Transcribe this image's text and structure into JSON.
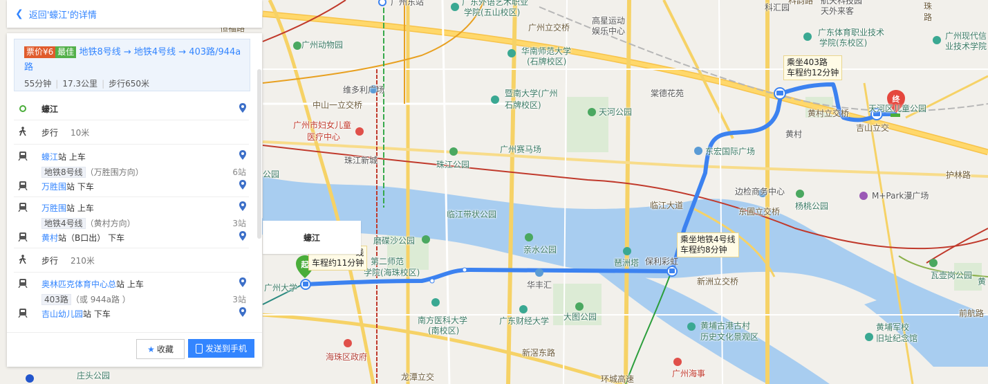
{
  "nav": {
    "back_label": "返回'蠔江'的详情"
  },
  "route": {
    "price_tag": "票价¥6",
    "best_tag": "最佳",
    "title": "地铁8号线 → 地铁4号线 → 403路/944a路",
    "duration": "55分钟",
    "distance": "17.3公里",
    "walk": "步行650米"
  },
  "steps": {
    "start": "蠔江",
    "walk1": "步行",
    "walk1_dist": "10米",
    "board1_station": "蠔江",
    "board1_suffix": "站  上车",
    "line1_name": "地铁8号线",
    "line1_dir": "（万胜围方向）",
    "line1_stops": "6站",
    "alight1_station": "万胜围",
    "alight1_suffix": "站  下车",
    "board2_station": "万胜围",
    "board2_suffix": "站  上车",
    "line2_name": "地铁4号线",
    "line2_dir": "（黄村方向）",
    "line2_stops": "3站",
    "alight2_station": "黄村",
    "alight2_suffix": "站（B口出）  下车",
    "walk2": "步行",
    "walk2_dist": "210米",
    "board3_station": "奥林匹克体育中心总",
    "board3_suffix": "站  上车",
    "line3_name": "403路",
    "line3_dir": "（或 944a路 ）",
    "line3_stops": "3站",
    "alight3_station": "吉山幼儿园",
    "alight3_suffix": "站  下车"
  },
  "footer": {
    "fav_label": "收藏",
    "send_label": "发送到手机"
  },
  "map": {
    "start_marker": "起",
    "end_marker": "终",
    "start_tag": "蠔江",
    "callouts": {
      "bus": [
        "乘坐403路",
        "车程约12分钟"
      ],
      "metro4": [
        "乘坐地铁4号线",
        "车程约8分钟"
      ],
      "metro8": [
        "线",
        "车程约11分钟"
      ]
    },
    "labels": {
      "l01": "广州东站",
      "l02": "广东外语艺术职业",
      "l03": "学院(五山校区)",
      "l04": "科韵路",
      "l05": "科汇园",
      "l06": "航天科技园",
      "l07": "天外来客",
      "l08": "珠",
      "l09": "路",
      "l10": "恒福路",
      "l11": "广州立交桥",
      "l12": "高星运动",
      "l13": "娱乐中心",
      "l14": "广东体育职业技术",
      "l15": "学院(东校区)",
      "l16": "广州现代信",
      "l17": "业技术学院",
      "l18": "广州动物园",
      "l19": "华南师范大学",
      "l20": "(石牌校区)",
      "l21": "维多利广场",
      "l22": "暨南大学(广州",
      "l23": "石牌校区)",
      "l24": "棠德花苑",
      "l25": "中山一立交桥",
      "l26": "天河公园",
      "l27": "黄村立交桥",
      "l28": "天河区儿童公园",
      "l29": "吉山立交",
      "l30": "广州市妇女儿童",
      "l31": "医疗中心",
      "l32": "黄村",
      "l33": "广州赛马场",
      "l34": "东宏国际广场",
      "l35": "珠江新城",
      "l36": "珠江公园",
      "l37": "公园",
      "l38": "护林路",
      "l39": "边检商务中心",
      "l40": "M+Park漫广场",
      "l41": "临江大道",
      "l42": "临江带状公园",
      "l43": "东圃立交桥",
      "l44": "杨桃公园",
      "l45": "磨碟沙公园",
      "l46": "亲水公园",
      "l47": "琶洲塔",
      "l48": "保利彩虹",
      "l49": "第二师范",
      "l50": "学院(海珠校区)",
      "l51": "华丰汇",
      "l52": "新洲立交桥",
      "l53": "瓦壶岗公园",
      "l54": "黄",
      "l55": "广州大学",
      "l56": "南方医科大学",
      "l57": "(南校区)",
      "l58": "广东财经大学",
      "l59": "大图公园",
      "l60": "黄埔古港古村",
      "l61": "历史文化景观区",
      "l62": "黄埔军校",
      "l63": "旧址纪念馆",
      "l64": "前航路",
      "l65": "海珠区政府",
      "l66": "新滘东路",
      "l67": "龙潭立交",
      "l68": "庄头公园",
      "l69": "广州海事",
      "l70": "学",
      "l71": "环城高速"
    }
  },
  "colors": {
    "accent": "#3385ff",
    "metro8": "#2b9e3b",
    "metro3": "#e0a020",
    "red_line": "#c0392b"
  }
}
